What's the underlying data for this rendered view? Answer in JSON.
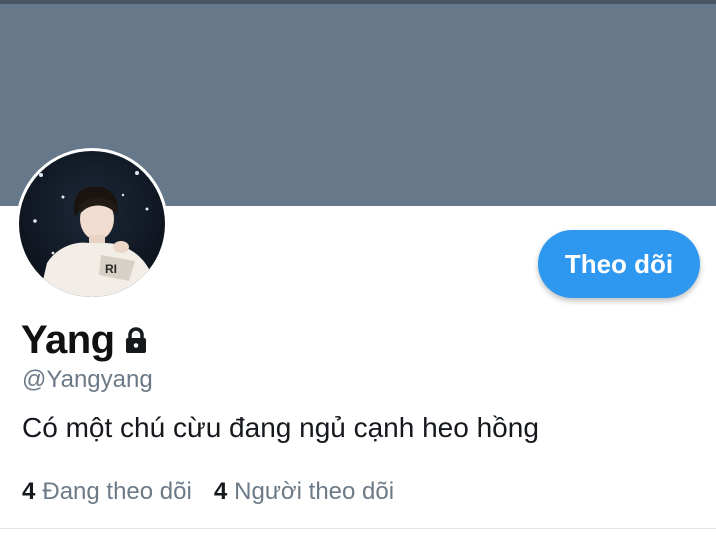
{
  "banner": {
    "color": "#667889"
  },
  "avatar": {
    "icon": "profile-photo",
    "alt": "Yang"
  },
  "profile": {
    "display_name": "Yang",
    "handle": "@Yangyang",
    "bio": "Có một chú cừu đang ngủ cạnh heo hồng",
    "locked_icon": "lock-icon"
  },
  "actions": {
    "follow_label": "Theo dõi",
    "follow_color": "#2e97ef"
  },
  "stats": {
    "following_count": "4",
    "following_label": "Đang theo dõi",
    "followers_count": "4",
    "followers_label": "Người theo dõi"
  },
  "colors": {
    "text_primary": "#15191e",
    "text_secondary": "#6c7a88"
  }
}
